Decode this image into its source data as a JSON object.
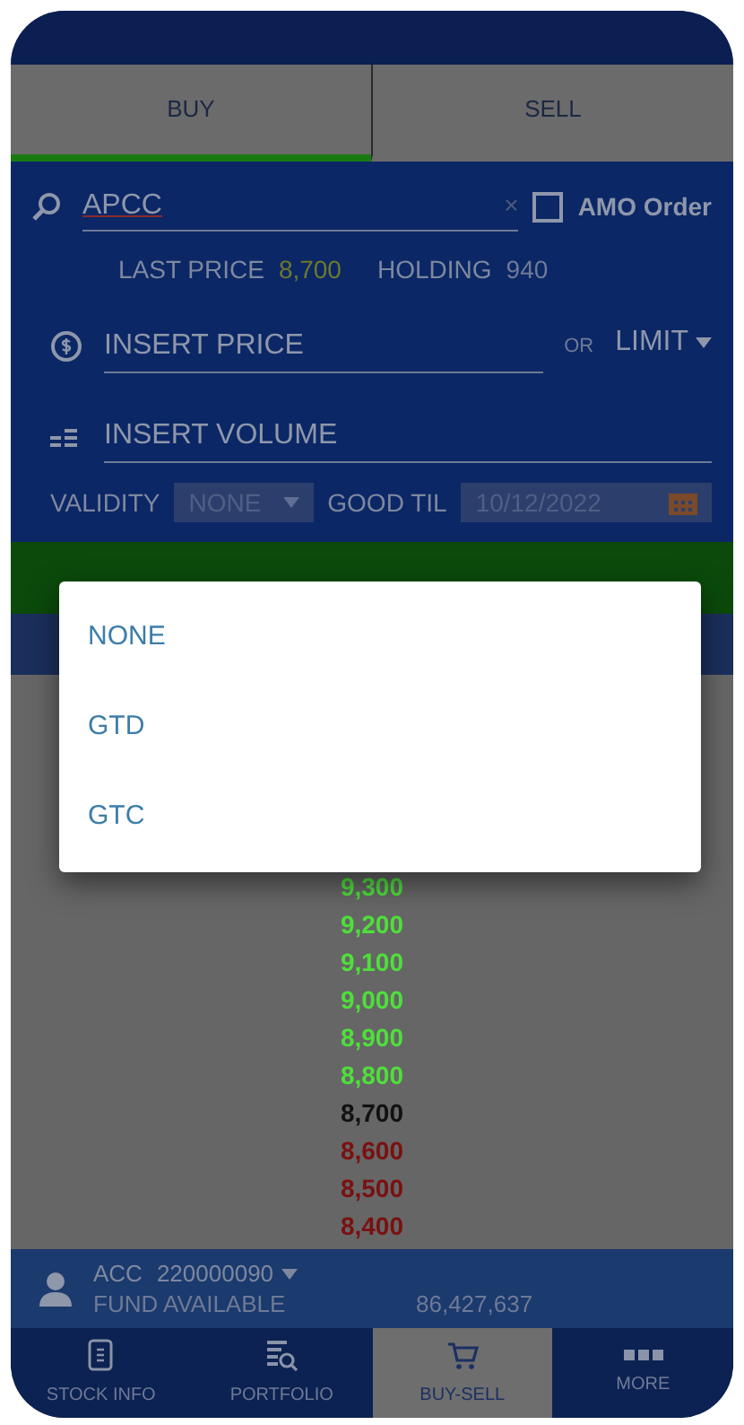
{
  "tabs": [
    {
      "label": "BUY",
      "selected": true
    },
    {
      "label": "SELL",
      "selected": false
    }
  ],
  "order_form": {
    "symbol": "APCC",
    "clear_symbol": "×",
    "amo_order": {
      "label": "AMO Order",
      "checked": false
    },
    "last_price_label": "LAST PRICE",
    "last_price": "8,700",
    "holding_label": "HOLDING",
    "holding": "940",
    "price_placeholder": "INSERT PRICE",
    "or_label": "OR",
    "price_type": "LIMIT",
    "volume_placeholder": "INSERT VOLUME",
    "validity_label": "VALIDITY",
    "validity": "NONE",
    "good_til_label": "GOOD TIL",
    "good_til": "10/12/2022"
  },
  "price_ladder": [
    {
      "price": "9,300",
      "kind": "up"
    },
    {
      "price": "9,200",
      "kind": "up"
    },
    {
      "price": "9,100",
      "kind": "up"
    },
    {
      "price": "9,000",
      "kind": "up"
    },
    {
      "price": "8,900",
      "kind": "up"
    },
    {
      "price": "8,800",
      "kind": "up"
    },
    {
      "price": "8,700",
      "kind": "ref"
    },
    {
      "price": "8,600",
      "kind": "down"
    },
    {
      "price": "8,500",
      "kind": "down"
    },
    {
      "price": "8,400",
      "kind": "down"
    }
  ],
  "validity_menu": [
    "NONE",
    "GTD",
    "GTC"
  ],
  "account": {
    "label": "ACC",
    "number": "220000090",
    "fund_label": "FUND AVAILABLE",
    "fund": "86,427,637"
  },
  "bottom_nav": [
    {
      "label": "STOCK INFO",
      "selected": false
    },
    {
      "label": "PORTFOLIO",
      "selected": false
    },
    {
      "label": "BUY-SELL",
      "selected": true
    },
    {
      "label": "MORE",
      "selected": false
    }
  ]
}
